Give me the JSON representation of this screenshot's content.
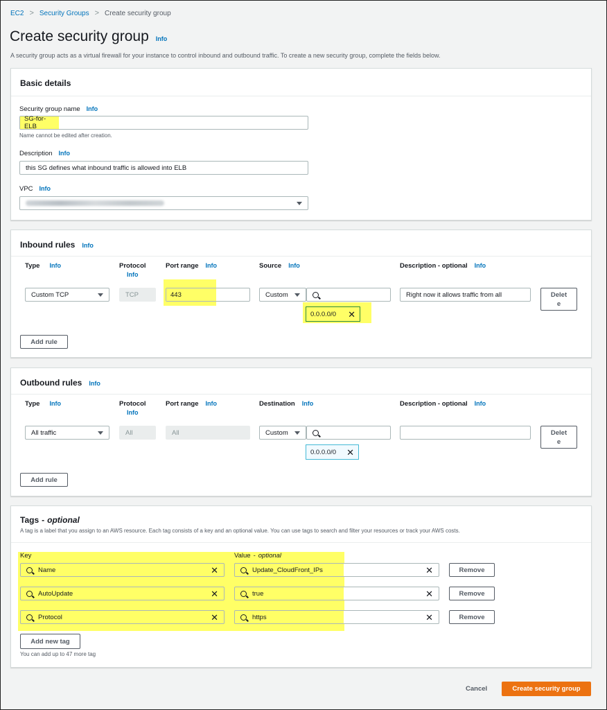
{
  "breadcrumb": {
    "ec2": "EC2",
    "security_groups": "Security Groups",
    "current": "Create security group"
  },
  "page": {
    "title": "Create security group",
    "info": "Info",
    "subtitle": "A security group acts as a virtual firewall for your instance to control inbound and outbound traffic. To create a new security group, complete the fields below."
  },
  "basic": {
    "title": "Basic details",
    "name_label": "Security group name",
    "name_value": "SG-for-ELB",
    "name_hint": "Name cannot be edited after creation.",
    "desc_label": "Description",
    "desc_value": "this SG defines what inbound traffic is allowed into ELB",
    "vpc_label": "VPC"
  },
  "inbound": {
    "title": "Inbound rules",
    "col_type": "Type",
    "col_protocol": "Protocol",
    "col_port": "Port range",
    "col_source": "Source",
    "col_desc": "Description - optional",
    "type_value": "Custom TCP",
    "protocol_value": "TCP",
    "port_value": "443",
    "source_type": "Custom",
    "source_token": "0.0.0.0/0",
    "desc_value": "Right now it allows traffic from all",
    "delete_line1": "Delet",
    "delete_line2": "e",
    "add_rule": "Add rule"
  },
  "outbound": {
    "title": "Outbound rules",
    "col_type": "Type",
    "col_protocol": "Protocol",
    "col_port": "Port range",
    "col_dest": "Destination",
    "col_desc": "Description - optional",
    "type_value": "All traffic",
    "protocol_value": "All",
    "port_value": "All",
    "dest_type": "Custom",
    "dest_token": "0.0.0.0/0",
    "delete_line1": "Delet",
    "delete_line2": "e",
    "add_rule": "Add rule"
  },
  "tags": {
    "title": "Tags",
    "title_suffix": "optional",
    "description": "A tag is a label that you assign to an AWS resource. Each tag consists of a key and an optional value. You can use tags to search and filter your resources or track your AWS costs.",
    "key_label": "Key",
    "value_label": "Value",
    "value_suffix": "optional",
    "rows": [
      {
        "key": "Name",
        "value": "Update_CloudFront_IPs",
        "remove": "Remove"
      },
      {
        "key": "AutoUpdate",
        "value": "true",
        "remove": "Remove"
      },
      {
        "key": "Protocol",
        "value": "https",
        "remove": "Remove"
      }
    ],
    "add_tag": "Add new tag",
    "limit_hint": "You can add up to 47 more tag"
  },
  "footer": {
    "cancel": "Cancel",
    "create": "Create security group"
  },
  "colors": {
    "accent": "#ec7211",
    "link": "#0073bb",
    "highlight": "#ffff66"
  }
}
